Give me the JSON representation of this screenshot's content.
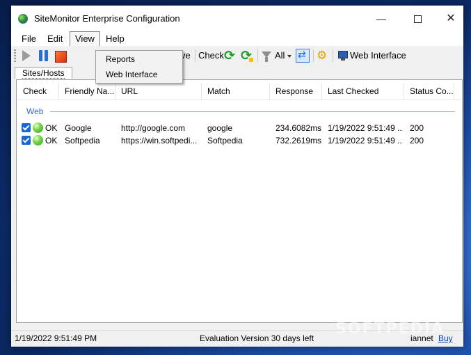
{
  "window": {
    "title": "SiteMonitor Enterprise Configuration",
    "minimize": "—",
    "close": "✕"
  },
  "menu": {
    "file": "File",
    "edit": "Edit",
    "view": "View",
    "help": "Help"
  },
  "view_menu": {
    "items": [
      "Reports",
      "Web Interface"
    ]
  },
  "toolbar": {
    "remove": "move",
    "check": "Check",
    "all": "All",
    "web_interface": "Web Interface",
    "gear": "⚙"
  },
  "tabs": {
    "sites": "Sites/Hosts"
  },
  "grid": {
    "columns": [
      "Check",
      "Friendly Na...",
      "URL",
      "Match",
      "Response",
      "Last Checked",
      "Status Co..."
    ],
    "group": "Web",
    "rows": [
      {
        "status": "OK",
        "name": "Google",
        "url": "http://google.com",
        "match": "google",
        "response": "234.6082ms",
        "last_checked": "1/19/2022 9:51:49 ...",
        "status_code": "200"
      },
      {
        "status": "OK",
        "name": "Softpedia",
        "url": "https://win.softpedi...",
        "match": "Softpedia",
        "response": "732.2619ms",
        "last_checked": "1/19/2022 9:51:49 ...",
        "status_code": "200"
      }
    ]
  },
  "statusbar": {
    "time": "1/19/2022 9:51:49 PM",
    "evaluation": "Evaluation Version 30 days left",
    "user": "iannet",
    "buy": "Buy"
  },
  "watermark": "SOFTPEDIA"
}
